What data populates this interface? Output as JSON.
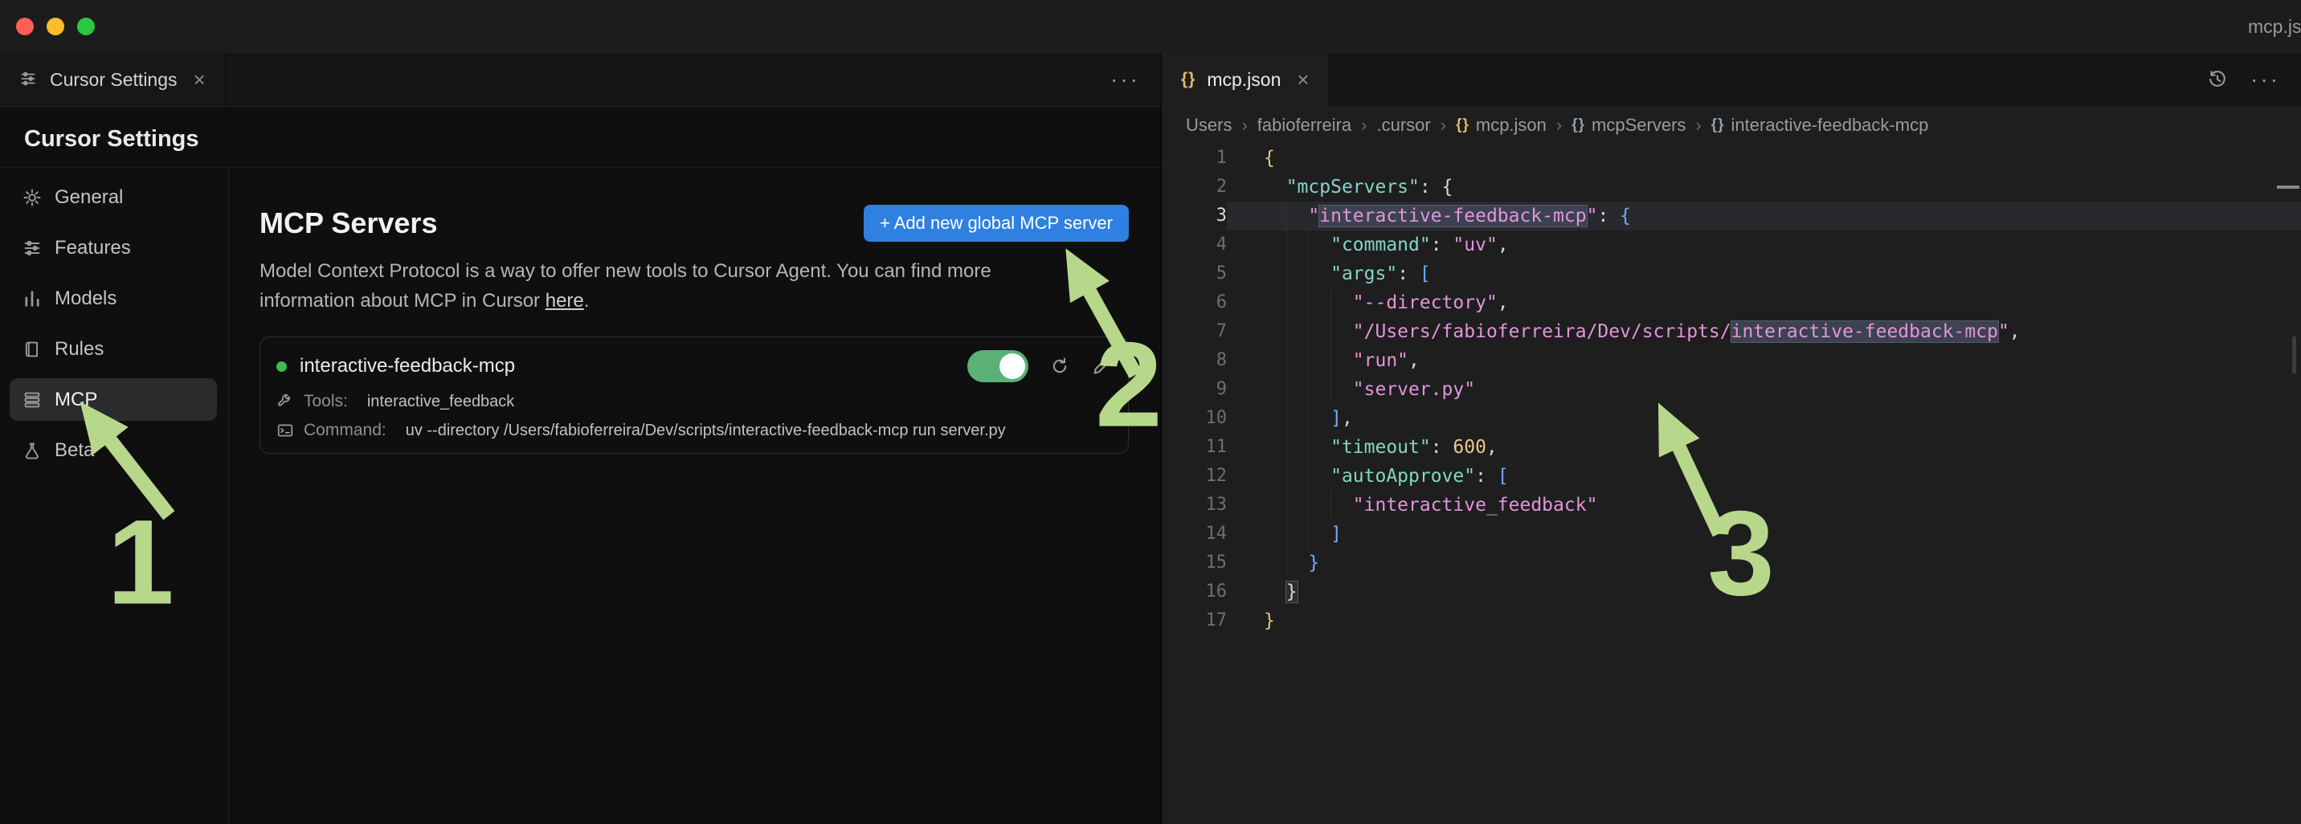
{
  "colors": {
    "accent": "#2f80e0",
    "toggle_on": "#5cb176",
    "status_green": "#3fb950",
    "annotation": "#b7d88b"
  },
  "window": {
    "title": "mcp.json",
    "traffic_lights": [
      {
        "name": "close",
        "color": "#ff5f57"
      },
      {
        "name": "minimize",
        "color": "#febc2e"
      },
      {
        "name": "zoom",
        "color": "#28c840"
      }
    ]
  },
  "left_pane": {
    "tab": {
      "label": "Cursor Settings",
      "close": "×"
    },
    "more": "···",
    "page_title": "Cursor Settings",
    "sidebar": {
      "items": [
        {
          "label": "General",
          "icon": "gear",
          "active": false
        },
        {
          "label": "Features",
          "icon": "sliders",
          "active": false
        },
        {
          "label": "Models",
          "icon": "bars",
          "active": false
        },
        {
          "label": "Rules",
          "icon": "book",
          "active": false
        },
        {
          "label": "MCP",
          "icon": "stack",
          "active": true
        },
        {
          "label": "Beta",
          "icon": "flask",
          "active": false
        }
      ]
    },
    "mcp": {
      "title": "MCP Servers",
      "add_button": "+ Add new global MCP server",
      "description_line1": "Model Context Protocol is a way to offer new tools to Cursor Agent. You can find more",
      "description_line2": "information about MCP in Cursor ",
      "description_link": "here",
      "description_end": ".",
      "server": {
        "name": "interactive-feedback-mcp",
        "enabled": true,
        "tools_label": "Tools:",
        "tools_value": "interactive_feedback",
        "command_label": "Command:",
        "command_value": "uv --directory /Users/fabioferreira/Dev/scripts/interactive-feedback-mcp run server.py"
      }
    }
  },
  "right_pane": {
    "tab": {
      "icon": "{}",
      "label": "mcp.json",
      "close": "×"
    },
    "more": "···",
    "breadcrumbs": {
      "separator": "›",
      "items": [
        {
          "label": "Users"
        },
        {
          "label": "fabioferreira"
        },
        {
          "label": ".cursor"
        },
        {
          "label": "mcp.json",
          "icon": "json"
        },
        {
          "label": "mcpServers",
          "icon": "symbol"
        },
        {
          "label": "interactive-feedback-mcp",
          "icon": "symbol"
        }
      ]
    },
    "editor": {
      "lines": [
        {
          "n": 1,
          "tokens": [
            {
              "t": "{",
              "c": "b1"
            }
          ]
        },
        {
          "n": 2,
          "tokens": [
            {
              "t": "  ",
              "c": "pun"
            },
            {
              "t": "\"mcpServers\"",
              "c": "key"
            },
            {
              "t": ": ",
              "c": "pun"
            },
            {
              "t": "{",
              "c": "b2"
            }
          ]
        },
        {
          "n": 3,
          "current": true,
          "tokens": [
            {
              "t": "    ",
              "c": "pun"
            },
            {
              "t": "\"",
              "c": "str"
            },
            {
              "t": "interactive-feedback-mcp",
              "c": "str",
              "hl": true
            },
            {
              "t": "\"",
              "c": "str"
            },
            {
              "t": ": ",
              "c": "pun"
            },
            {
              "t": "{",
              "c": "b3"
            }
          ]
        },
        {
          "n": 4,
          "tokens": [
            {
              "t": "      ",
              "c": "pun"
            },
            {
              "t": "\"command\"",
              "c": "key"
            },
            {
              "t": ": ",
              "c": "pun"
            },
            {
              "t": "\"uv\"",
              "c": "str"
            },
            {
              "t": ",",
              "c": "pun"
            }
          ]
        },
        {
          "n": 5,
          "tokens": [
            {
              "t": "      ",
              "c": "pun"
            },
            {
              "t": "\"args\"",
              "c": "key"
            },
            {
              "t": ": ",
              "c": "pun"
            },
            {
              "t": "[",
              "c": "b3"
            }
          ]
        },
        {
          "n": 6,
          "tokens": [
            {
              "t": "        ",
              "c": "pun"
            },
            {
              "t": "\"--directory\"",
              "c": "str"
            },
            {
              "t": ",",
              "c": "pun"
            }
          ]
        },
        {
          "n": 7,
          "tokens": [
            {
              "t": "        ",
              "c": "pun"
            },
            {
              "t": "\"/Users/fabioferreira/Dev/scripts/",
              "c": "str"
            },
            {
              "t": "interactive-feedback-mcp",
              "c": "str",
              "hl": true
            },
            {
              "t": "\"",
              "c": "str"
            },
            {
              "t": ",",
              "c": "pun"
            }
          ]
        },
        {
          "n": 8,
          "tokens": [
            {
              "t": "        ",
              "c": "pun"
            },
            {
              "t": "\"run\"",
              "c": "str"
            },
            {
              "t": ",",
              "c": "pun"
            }
          ]
        },
        {
          "n": 9,
          "tokens": [
            {
              "t": "        ",
              "c": "pun"
            },
            {
              "t": "\"server.py\"",
              "c": "str"
            }
          ]
        },
        {
          "n": 10,
          "tokens": [
            {
              "t": "      ",
              "c": "pun"
            },
            {
              "t": "]",
              "c": "b3"
            },
            {
              "t": ",",
              "c": "pun"
            }
          ]
        },
        {
          "n": 11,
          "tokens": [
            {
              "t": "      ",
              "c": "pun"
            },
            {
              "t": "\"timeout\"",
              "c": "key"
            },
            {
              "t": ": ",
              "c": "pun"
            },
            {
              "t": "600",
              "c": "num"
            },
            {
              "t": ",",
              "c": "pun"
            }
          ]
        },
        {
          "n": 12,
          "tokens": [
            {
              "t": "      ",
              "c": "pun"
            },
            {
              "t": "\"autoApprove\"",
              "c": "key"
            },
            {
              "t": ": ",
              "c": "pun"
            },
            {
              "t": "[",
              "c": "b3"
            }
          ]
        },
        {
          "n": 13,
          "tokens": [
            {
              "t": "        ",
              "c": "pun"
            },
            {
              "t": "\"interactive_feedback\"",
              "c": "str"
            }
          ]
        },
        {
          "n": 14,
          "tokens": [
            {
              "t": "      ",
              "c": "pun"
            },
            {
              "t": "]",
              "c": "b3"
            }
          ]
        },
        {
          "n": 15,
          "tokens": [
            {
              "t": "    ",
              "c": "pun"
            },
            {
              "t": "}",
              "c": "b3"
            }
          ]
        },
        {
          "n": 16,
          "tokens": [
            {
              "t": "  ",
              "c": "pun"
            },
            {
              "t": "}",
              "c": "b2",
              "box": true
            }
          ]
        },
        {
          "n": 17,
          "tokens": [
            {
              "t": "}",
              "c": "b1"
            }
          ]
        }
      ]
    }
  },
  "annotations": {
    "numbers": [
      "1",
      "2",
      "3"
    ]
  }
}
